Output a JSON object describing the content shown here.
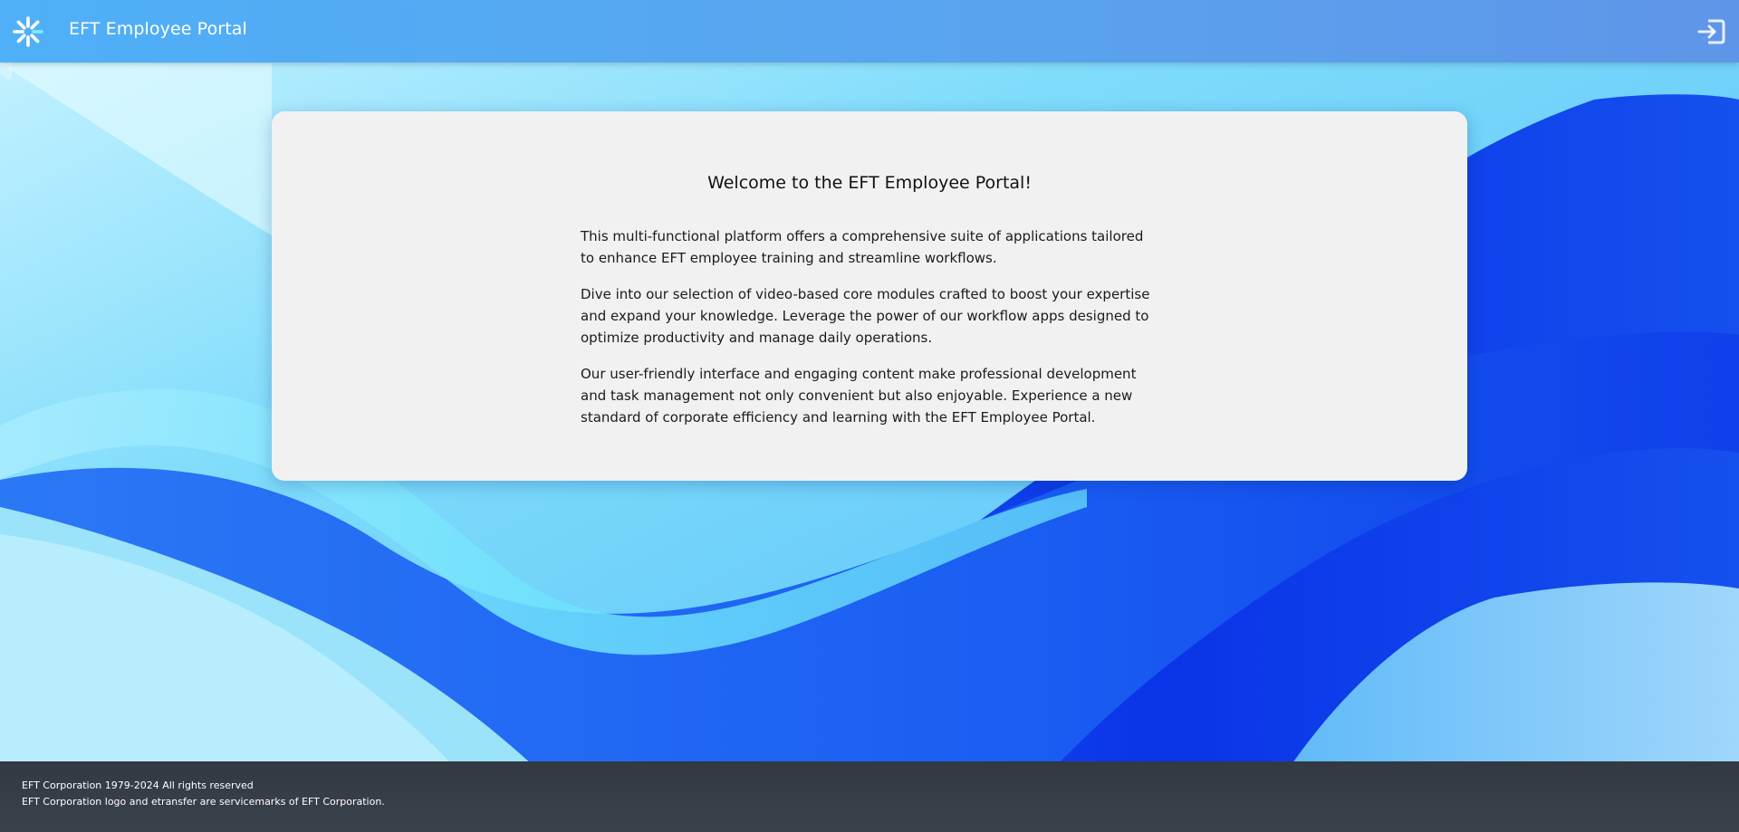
{
  "header": {
    "title": "EFT Employee Portal",
    "logo_icon": "spinner-burst-icon",
    "logout_icon": "sign-in-icon"
  },
  "card": {
    "title": "Welcome to the EFT Employee Portal!",
    "paragraphs": [
      "This multi-functional platform offers a comprehensive suite of applications tailored to enhance EFT employee training and streamline workflows.",
      "Dive into our selection of video-based core modules crafted to boost your expertise and expand your knowledge. Leverage the power of our workflow apps designed to optimize productivity and manage daily operations.",
      "Our user-friendly interface and engaging content make professional development and task management not only convenient but also enjoyable. Experience a new standard of corporate efficiency and learning with the EFT Employee Portal."
    ]
  },
  "footer": {
    "line1": "EFT Corporation 1979-2024 All rights reserved",
    "line2": "EFT Corporation logo and etransfer are servicemarks of EFT Corporation."
  },
  "colors": {
    "header": "#56a6f0",
    "card": "#f1f1f1",
    "footer": "#353c46",
    "wave_dark": "#0a35e6",
    "wave_light": "#72e4fb"
  }
}
